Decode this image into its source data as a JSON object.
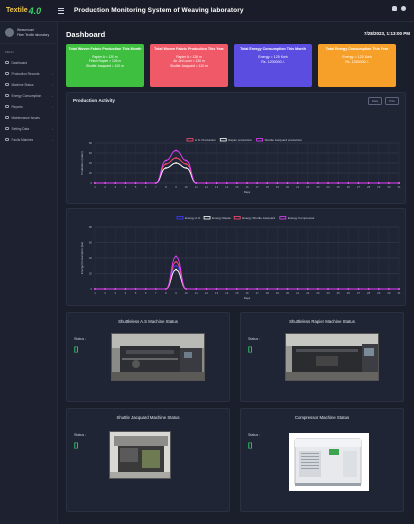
{
  "app": {
    "logo_a": "Textile",
    "logo_b": "4.0",
    "title": "Production Monitoring System of Weaving laboratory"
  },
  "sidebar": {
    "user_line1": "Weaveroom",
    "user_line2": "Fiber Textile laboratory",
    "heading": "MENU",
    "items": [
      {
        "label": "Dashboard",
        "icon": "home-icon"
      },
      {
        "label": "Production Records",
        "icon": "records-icon"
      },
      {
        "label": "Machine Status",
        "icon": "machine-icon"
      },
      {
        "label": "Energy Consumption",
        "icon": "energy-icon"
      },
      {
        "label": "Reports",
        "icon": "report-icon"
      },
      {
        "label": "Maintenance Issues",
        "icon": "wrench-icon"
      },
      {
        "label": "Setting Data",
        "icon": "gear-icon"
      },
      {
        "label": "Faults Matches",
        "icon": "alert-icon"
      }
    ]
  },
  "header": {
    "page_title": "Dashboard",
    "datetime": "7/28/2023, 1:13:00 PM"
  },
  "cards": [
    {
      "title": "Total Woven Fabric Production This Month",
      "lines": [
        "Rapier A = 120 m",
        "Finish Rapier = 126 m",
        "Shuttle Jacquard = 100 m"
      ],
      "color": "#3fbf3f"
    },
    {
      "title": "Total Woven Fabric Production This Year",
      "lines": [
        "Rapier A = 126 m",
        "Air Jet Loom = 130 m",
        "Shuttle Jacquard = 120 m"
      ],
      "color": "#f05a68"
    },
    {
      "title": "Total Energy Consumption This Month",
      "lines": [
        "Energy = 125 Kwh",
        "Rs. 1200000 /-"
      ],
      "color": "#5b4de0"
    },
    {
      "title": "Total Energy Consumption This Year",
      "lines": [
        "Energy = 125 Kwh",
        "Rs. 1250000 /-"
      ],
      "color": "#f6a02a"
    }
  ],
  "production_panel": {
    "title": "Production Activity",
    "btn_daily": "Daily",
    "btn_print": "Print"
  },
  "chart_data": [
    {
      "type": "line",
      "legend": [
        "A.S. Production",
        "Rapier production",
        "Shuttle Jacquard production"
      ],
      "colors": [
        "#ff4d6d",
        "#ffffff",
        "#e040fb"
      ],
      "ylabel": "Production (meter)",
      "xlabel": "Days",
      "ylim": [
        0,
        80
      ],
      "yticks": [
        0,
        20,
        40,
        60,
        80
      ],
      "x": [
        1,
        2,
        3,
        4,
        5,
        6,
        7,
        8,
        9,
        10,
        11,
        12,
        13,
        14,
        15,
        16,
        17,
        18,
        19,
        20,
        21,
        22,
        23,
        24,
        25,
        26,
        27,
        28,
        29,
        30,
        31
      ],
      "series": [
        {
          "name": "A.S. Production",
          "values": [
            0,
            0,
            0,
            0,
            0,
            0,
            0,
            38,
            50,
            38,
            0,
            0,
            0,
            0,
            0,
            0,
            0,
            0,
            0,
            0,
            0,
            0,
            0,
            0,
            0,
            0,
            0,
            0,
            0,
            0,
            0
          ]
        },
        {
          "name": "Rapier production",
          "values": [
            0,
            0,
            0,
            0,
            0,
            0,
            0,
            30,
            40,
            30,
            0,
            0,
            0,
            0,
            0,
            0,
            0,
            0,
            0,
            0,
            0,
            0,
            0,
            0,
            0,
            0,
            0,
            0,
            0,
            0,
            0
          ]
        },
        {
          "name": "Shuttle Jacquard production",
          "values": [
            0,
            0,
            0,
            0,
            0,
            0,
            0,
            45,
            65,
            45,
            0,
            0,
            0,
            0,
            0,
            0,
            0,
            0,
            0,
            0,
            0,
            0,
            0,
            0,
            0,
            0,
            0,
            0,
            0,
            0,
            0
          ]
        }
      ]
    },
    {
      "type": "line",
      "legend": [
        "Energy A.S.",
        "Energy Rapier",
        "Energy Shuttle Jacquard",
        "Energy Compressor"
      ],
      "colors": [
        "#3b3bff",
        "#ffffff",
        "#ff4d6d",
        "#e040fb"
      ],
      "ylabel": "Energy Consumption (kw)",
      "xlabel": "Days",
      "ylim": [
        0,
        80
      ],
      "yticks": [
        0,
        20,
        40,
        60,
        80
      ],
      "x": [
        1,
        2,
        3,
        4,
        5,
        6,
        7,
        8,
        9,
        10,
        11,
        12,
        13,
        14,
        15,
        16,
        17,
        18,
        19,
        20,
        21,
        22,
        23,
        24,
        25,
        26,
        27,
        28,
        29,
        30,
        31
      ],
      "series": [
        {
          "name": "Energy A.S.",
          "values": [
            0,
            0,
            0,
            0,
            0,
            0,
            0,
            0,
            30,
            0,
            0,
            0,
            0,
            0,
            0,
            0,
            0,
            0,
            0,
            0,
            0,
            0,
            0,
            0,
            0,
            0,
            0,
            0,
            0,
            0,
            0
          ]
        },
        {
          "name": "Energy Rapier",
          "values": [
            0,
            0,
            0,
            0,
            0,
            0,
            0,
            0,
            25,
            0,
            0,
            0,
            0,
            0,
            0,
            0,
            0,
            0,
            0,
            0,
            0,
            0,
            0,
            0,
            0,
            0,
            0,
            0,
            0,
            0,
            0
          ]
        },
        {
          "name": "Energy Shuttle Jacquard",
          "values": [
            0,
            0,
            0,
            0,
            0,
            0,
            0,
            0,
            35,
            0,
            0,
            0,
            0,
            0,
            0,
            0,
            0,
            0,
            0,
            0,
            0,
            0,
            0,
            0,
            0,
            0,
            0,
            0,
            0,
            0,
            0
          ]
        },
        {
          "name": "Energy Compressor",
          "values": [
            0,
            0,
            0,
            0,
            0,
            0,
            0,
            0,
            42,
            0,
            0,
            0,
            0,
            0,
            0,
            0,
            0,
            0,
            0,
            0,
            0,
            0,
            0,
            0,
            0,
            0,
            0,
            0,
            0,
            0,
            0
          ]
        }
      ]
    }
  ],
  "machines": [
    {
      "title": "Shuttleless A.S Machine Status",
      "status_label": "Status :",
      "status_value": "[]"
    },
    {
      "title": "Shuttleless Rapier Machine Status",
      "status_label": "Status :",
      "status_value": "[]"
    },
    {
      "title": "Shuttle Jacquard Machine Status",
      "status_label": "Status :",
      "status_value": "[]"
    },
    {
      "title": "Compressor Machine Status",
      "status_label": "Status :",
      "status_value": "[]"
    }
  ]
}
